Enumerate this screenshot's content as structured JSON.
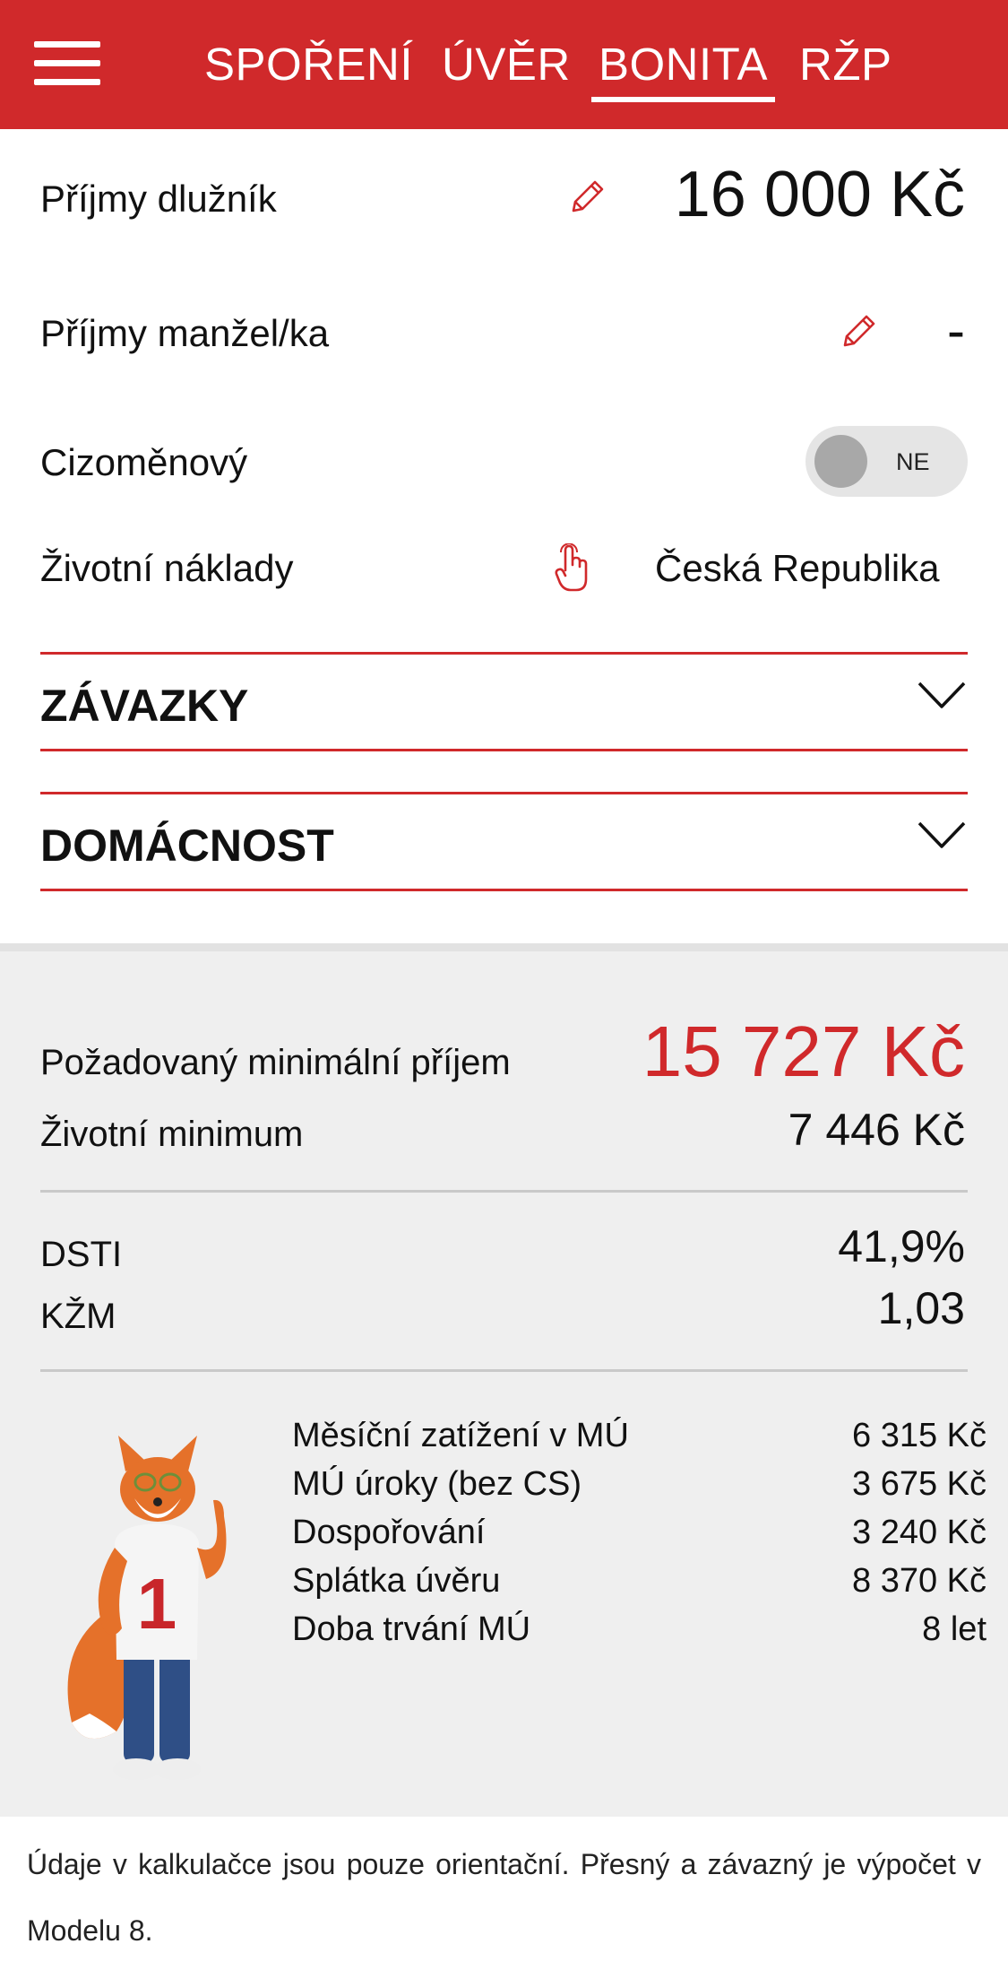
{
  "nav": {
    "tabs": [
      {
        "label": "SPOŘENÍ"
      },
      {
        "label": "ÚVĚR"
      },
      {
        "label": "BONITA",
        "active": true
      },
      {
        "label": "RŽP"
      }
    ]
  },
  "form": {
    "debtor_income": {
      "label": "Příjmy dlužník",
      "value": "16 000 Kč"
    },
    "spouse_income": {
      "label": "Příjmy manžel/ka",
      "value": "-"
    },
    "foreign_currency": {
      "label": "Cizoměnový",
      "toggle_text": "NE"
    },
    "living_costs": {
      "label": "Životní náklady",
      "value": "Česká Republika"
    }
  },
  "sections": {
    "obligations": "ZÁVAZKY",
    "household": "DOMÁCNOST"
  },
  "summary": {
    "required_income": {
      "label": "Požadovaný minimální příjem",
      "value": "15 727 Kč"
    },
    "living_minimum": {
      "label": "Životní minimum",
      "value": "7 446 Kč"
    },
    "dsti": {
      "label": "DSTI",
      "value": "41,9%"
    },
    "kzm": {
      "label": "KŽM",
      "value": "1,03"
    },
    "details": [
      {
        "label": "Měsíční zatížení v MÚ",
        "value": "6 315 Kč"
      },
      {
        "label": "MÚ úroky (bez CS)",
        "value": "3 675 Kč"
      },
      {
        "label": "Dospořování",
        "value": "3 240 Kč"
      },
      {
        "label": "Splátka úvěru",
        "value": "8 370 Kč"
      },
      {
        "label": "Doba trvání MÚ",
        "value": "8 let"
      }
    ],
    "mascot_badge": "1"
  },
  "footer": {
    "disclaimer": "Údaje v kalkulačce jsou pouze orientační. Přesný a závazný je výpočet v Modelu 8."
  },
  "colors": {
    "brand_red": "#d0292b",
    "summary_bg": "#efefef"
  },
  "icons": [
    "menu-icon",
    "pencil-icon",
    "hand-pointer-icon",
    "chevron-down-icon"
  ]
}
